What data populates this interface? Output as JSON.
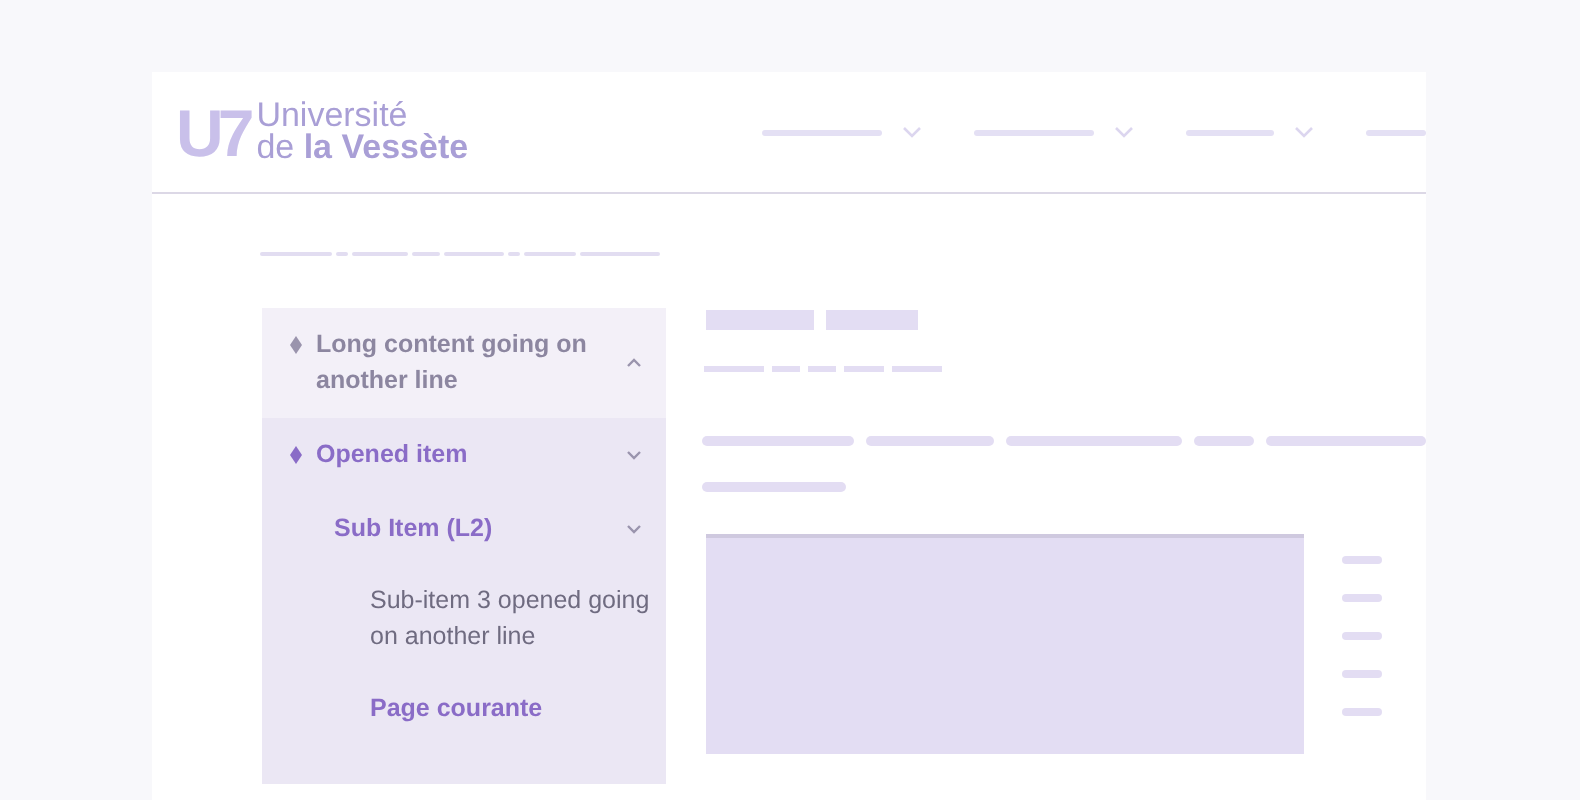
{
  "logo": {
    "mark": "U7",
    "line1": "Université",
    "line2": "de **la Vessète**"
  },
  "sidebar": {
    "items": [
      {
        "label": "Long content going on another line",
        "active": false,
        "expanded": false
      },
      {
        "label": "Opened item",
        "active": true,
        "expanded": true,
        "children": [
          {
            "label": "Sub Item (L2)",
            "active": true,
            "expanded": true,
            "children": [
              {
                "label": "Sub-item 3 opened going on another line",
                "active": false
              },
              {
                "label": "Page courante",
                "active": true
              }
            ]
          }
        ]
      }
    ]
  }
}
